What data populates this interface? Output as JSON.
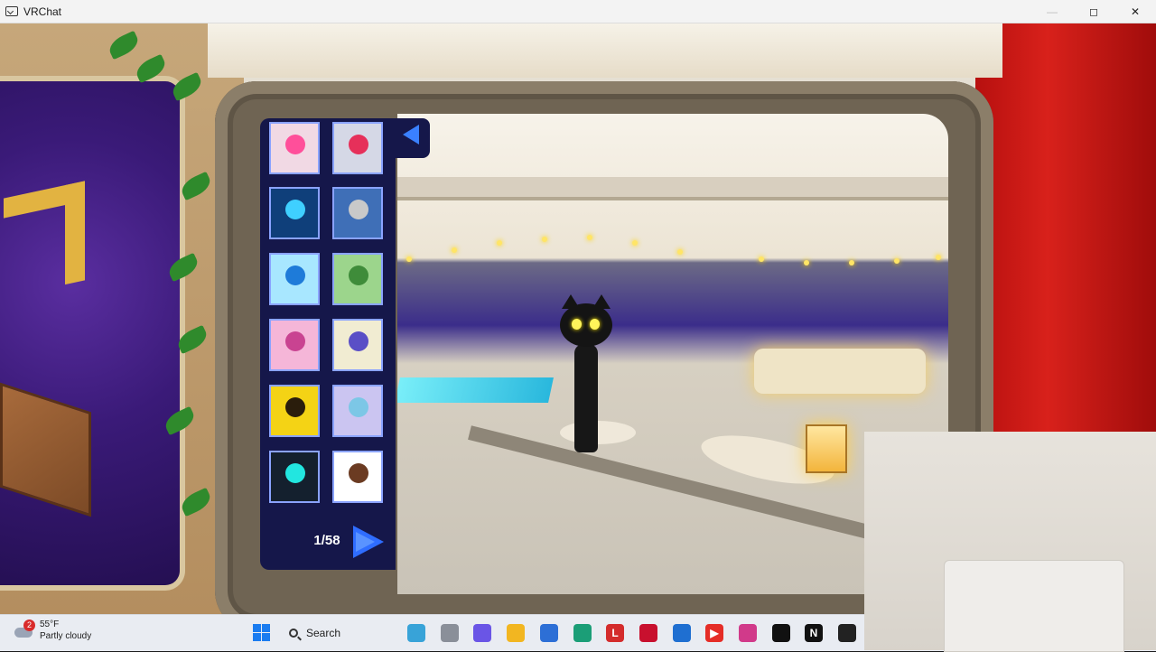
{
  "window": {
    "title": "VRChat",
    "controls": {
      "minimize": "—",
      "maximize": "◻",
      "close": "✕"
    }
  },
  "avatar_picker": {
    "page_indicator": "1/58",
    "back_icon": "arrow-left-icon",
    "next_icon": "arrow-right-icon",
    "tiles": [
      {
        "name": "avatar-thumb-1",
        "bg": "#f1d9e4",
        "accent": "#ff4f9a"
      },
      {
        "name": "avatar-thumb-2",
        "bg": "#d5d8e6",
        "accent": "#e6305a"
      },
      {
        "name": "avatar-thumb-3",
        "bg": "#0f3f7a",
        "accent": "#3fd0ff"
      },
      {
        "name": "avatar-thumb-4",
        "bg": "#3f6fb7",
        "accent": "#c9c9c9"
      },
      {
        "name": "avatar-thumb-5",
        "bg": "#a8e7ff",
        "accent": "#1e7bd9"
      },
      {
        "name": "avatar-thumb-6",
        "bg": "#9cd58c",
        "accent": "#3f8c3a"
      },
      {
        "name": "avatar-thumb-7",
        "bg": "#f5b6d8",
        "accent": "#c94391"
      },
      {
        "name": "avatar-thumb-8",
        "bg": "#f1ecd2",
        "accent": "#5a4fc6"
      },
      {
        "name": "avatar-thumb-9",
        "bg": "#f4d315",
        "accent": "#2a1d0c"
      },
      {
        "name": "avatar-thumb-10",
        "bg": "#cbc5f1",
        "accent": "#7cc7e6"
      },
      {
        "name": "avatar-thumb-11",
        "bg": "#14202e",
        "accent": "#22e6e0"
      },
      {
        "name": "avatar-thumb-12",
        "bg": "#ffffff",
        "accent": "#6b3b22"
      }
    ]
  },
  "taskbar": {
    "weather": {
      "temperature": "55°F",
      "condition": "Partly cloudy",
      "badge": "2"
    },
    "search_label": "Search",
    "apps": [
      {
        "name": "copilot-icon",
        "color": "#38a3d8",
        "glyph": ""
      },
      {
        "name": "task-view-icon",
        "color": "#8a8f99",
        "glyph": ""
      },
      {
        "name": "copilot-app-icon",
        "color": "#6a55e6",
        "glyph": ""
      },
      {
        "name": "file-explorer-icon",
        "color": "#f2b621",
        "glyph": ""
      },
      {
        "name": "microsoft-store-icon",
        "color": "#2d6fd6",
        "glyph": ""
      },
      {
        "name": "edge-icon",
        "color": "#1b9e77",
        "glyph": ""
      },
      {
        "name": "app-l-icon",
        "color": "#d42c2c",
        "glyph": "L"
      },
      {
        "name": "mcafee-icon",
        "color": "#c8102e",
        "glyph": ""
      },
      {
        "name": "outlook-icon",
        "color": "#1f6fd1",
        "glyph": ""
      },
      {
        "name": "youtube-icon",
        "color": "#e52d27",
        "glyph": "▶"
      },
      {
        "name": "instagram-icon",
        "color": "#d13a8a",
        "glyph": ""
      },
      {
        "name": "roblox-icon",
        "color": "#111111",
        "glyph": ""
      },
      {
        "name": "netflix-icon",
        "color": "#111111",
        "glyph": "N"
      },
      {
        "name": "vrchat-taskbar-icon",
        "color": "#222222",
        "glyph": ""
      }
    ]
  }
}
